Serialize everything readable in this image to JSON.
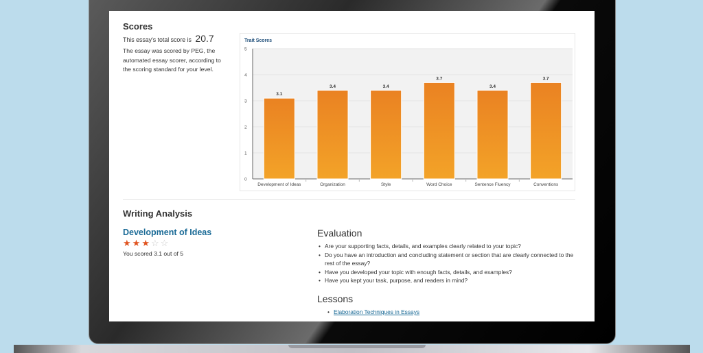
{
  "scores": {
    "heading": "Scores",
    "total_prefix": "This essay's total score is",
    "total_value": "20.7",
    "description": "The essay was scored by PEG, the automated essay scorer, according to the scoring standard for your level."
  },
  "chart_data": {
    "type": "bar",
    "title": "Trait Scores",
    "categories": [
      "Development of Ideas",
      "Organization",
      "Style",
      "Word Choice",
      "Sentence Fluency",
      "Conventions"
    ],
    "values": [
      3.1,
      3.4,
      3.4,
      3.7,
      3.4,
      3.7
    ],
    "data_labels": [
      "3.1",
      "3.4",
      "3.4",
      "3.7",
      "3.4",
      "3.7"
    ],
    "ylim": [
      0,
      5
    ],
    "yticks": [
      "0",
      "1",
      "2",
      "3",
      "4",
      "5"
    ],
    "grid": true,
    "colors": {
      "bar_top": "#ea8222",
      "bar_bottom": "#f3a328",
      "plot_bg": "#f2f2f2"
    }
  },
  "analysis": {
    "heading": "Writing Analysis",
    "trait": {
      "name": "Development of Ideas",
      "rating": 3,
      "max_rating": 5,
      "score_text": "You scored 3.1 out of 5"
    },
    "evaluation": {
      "heading": "Evaluation",
      "items": [
        "Are your supporting facts, details, and examples clearly related to your topic?",
        "Do you have an introduction and concluding statement or section that are clearly connected to the rest of the essay?",
        "Have you developed your topic with enough facts, details, and examples?",
        "Have you kept your task, purpose, and readers in mind?"
      ]
    },
    "lessons": {
      "heading": "Lessons",
      "items": [
        "Elaboration Techniques in Essays"
      ]
    }
  },
  "colors": {
    "accent": "#1a6a96",
    "star": "#e0531f",
    "background": "#bcdcec"
  }
}
